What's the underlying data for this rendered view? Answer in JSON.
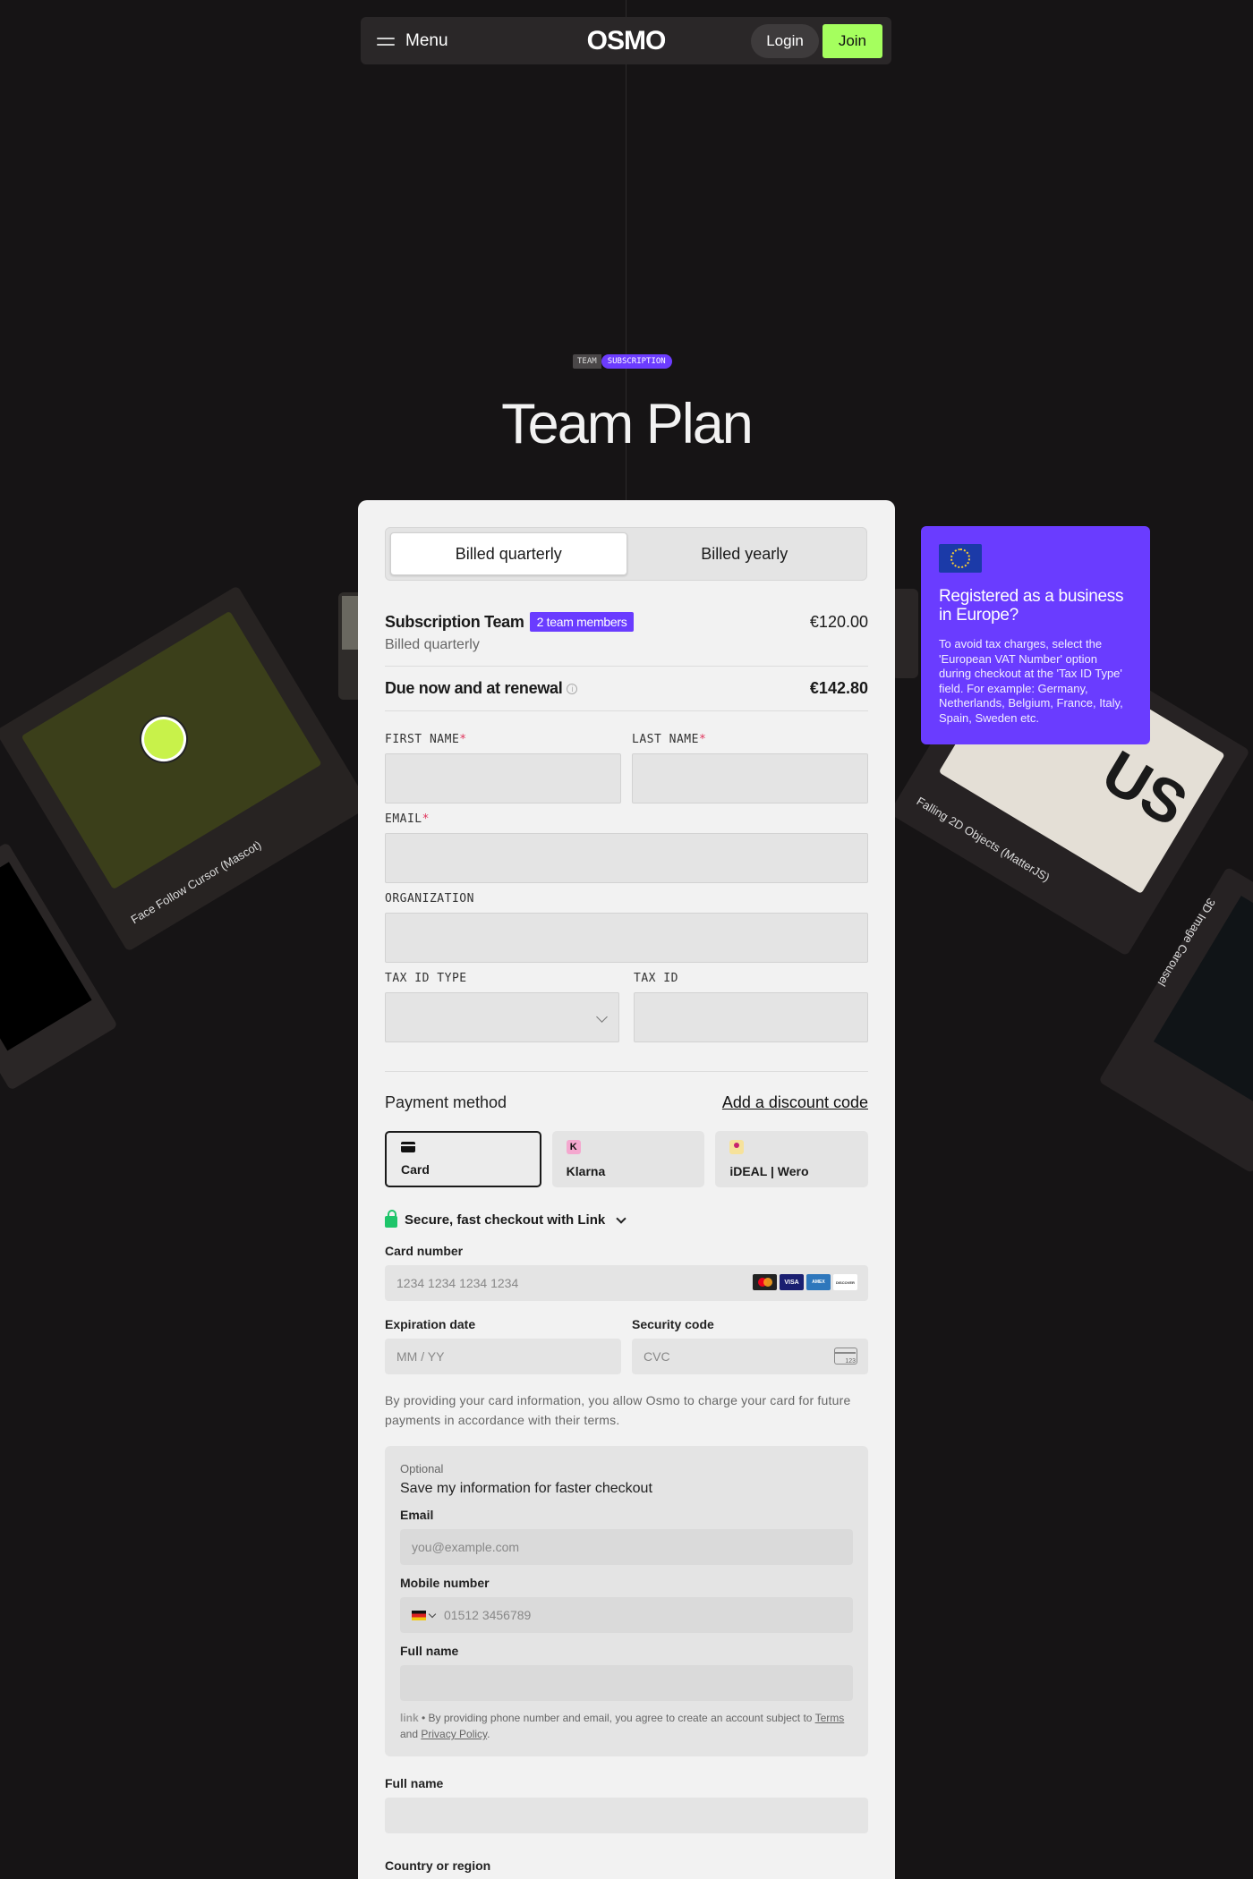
{
  "nav": {
    "menu_label": "Menu",
    "logo": "OSMO",
    "login_label": "Login",
    "join_label": "Join",
    "colors": {
      "join_bg": "#a5ff5e",
      "nav_bg": "#2a2728"
    }
  },
  "hero": {
    "badge_team": "TEAM",
    "badge_subscription": "SUBSCRIPTION",
    "title": "Team Plan"
  },
  "background_cards": {
    "face_caption": "Face Follow Cursor (Mascot)",
    "falling_caption": "Falling 2D Objects (MatterJS)",
    "falling_word": "US",
    "carousel_caption": "3D Image Carousel"
  },
  "eu_card": {
    "title": "Registered as a business in Europe?",
    "body": "To avoid tax charges, select the 'European VAT Number' option during checkout at the 'Tax ID Type' field. For example: Germany, Netherlands, Belgium, France, Italy, Spain, Sweden etc.",
    "flag_icon": "eu-flag-icon",
    "color": "#6a3cff"
  },
  "checkout": {
    "billing": {
      "quarterly": "Billed quarterly",
      "yearly": "Billed yearly",
      "selected": "quarterly"
    },
    "summary": {
      "title": "Subscription Team",
      "members_badge": "2 team members",
      "price": "€120.00",
      "billed": "Billed quarterly",
      "due_label": "Due now and at renewal",
      "due_price": "€142.80"
    },
    "fields": {
      "first_name": "FIRST NAME",
      "last_name": "LAST NAME",
      "email": "EMAIL",
      "organization": "ORGANIZATION",
      "tax_id_type": "TAX ID TYPE",
      "tax_id": "TAX ID",
      "required_mark": "*"
    },
    "payment": {
      "title": "Payment method",
      "discount": "Add a discount code",
      "tabs": [
        {
          "label": "Card",
          "icon": "card-icon"
        },
        {
          "label": "Klarna",
          "icon": "klarna-icon",
          "glyph": "K"
        },
        {
          "label": "iDEAL | Wero",
          "icon": "ideal-icon"
        }
      ],
      "link_text": "Secure, fast checkout with Link",
      "card_number_label": "Card number",
      "card_number_placeholder": "1234 1234 1234 1234",
      "brands": [
        "mastercard",
        "VISA",
        "AMEX",
        "DISCOVER"
      ],
      "expiry_label": "Expiration date",
      "expiry_placeholder": "MM / YY",
      "cvc_label": "Security code",
      "cvc_placeholder": "CVC",
      "consent": "By providing your card information, you allow Osmo to charge your card for future payments in accordance with their terms."
    },
    "save": {
      "optional": "Optional",
      "title": "Save my information for faster checkout",
      "email_label": "Email",
      "email_placeholder": "you@example.com",
      "mobile_label": "Mobile number",
      "mobile_placeholder": "01512 3456789",
      "fullname_label": "Full name",
      "link_logo": "link",
      "fine_prefix": " • By providing phone number and email, you agree to create an account subject to ",
      "terms": "Terms",
      "and": " and ",
      "privacy": "Privacy Policy",
      "period": "."
    },
    "billing_fullname_label": "Full name",
    "country_label": "Country or region"
  }
}
